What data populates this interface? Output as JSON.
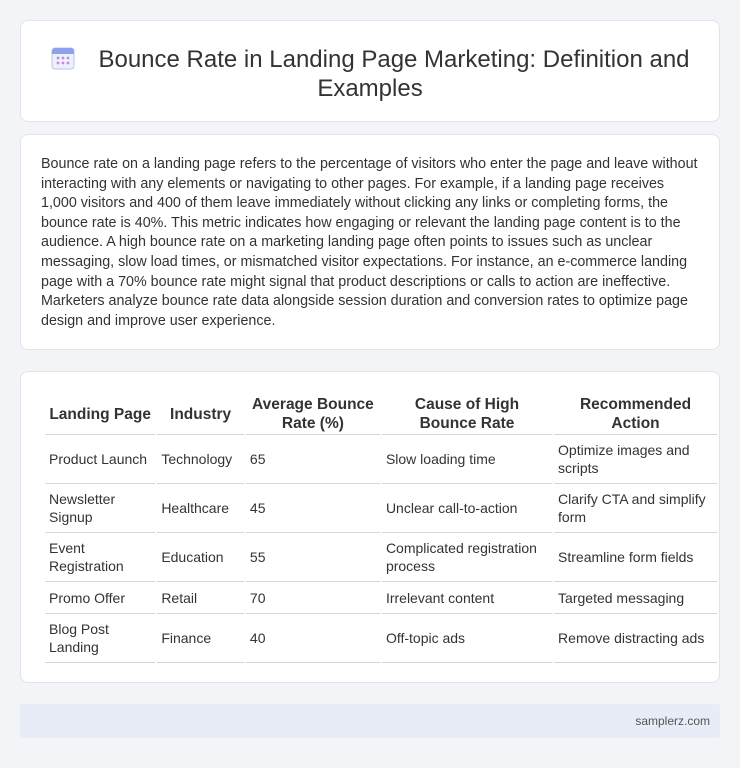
{
  "header": {
    "title": "Bounce Rate in Landing Page Marketing: Definition and Examples",
    "icon": "calendar-icon"
  },
  "description": "Bounce rate on a landing page refers to the percentage of visitors who enter the page and leave without interacting with any elements or navigating to other pages. For example, if a landing page receives 1,000 visitors and 400 of them leave immediately without clicking any links or completing forms, the bounce rate is 40%. This metric indicates how engaging or relevant the landing page content is to the audience. A high bounce rate on a marketing landing page often points to issues such as unclear messaging, slow load times, or mismatched visitor expectations. For instance, an e-commerce landing page with a 70% bounce rate might signal that product descriptions or calls to action are ineffective. Marketers analyze bounce rate data alongside session duration and conversion rates to optimize page design and improve user experience.",
  "table": {
    "headers": [
      "Landing Page",
      "Industry",
      "Average Bounce Rate (%)",
      "Cause of High Bounce Rate",
      "Recommended Action"
    ],
    "rows": [
      [
        "Product Launch",
        "Technology",
        "65",
        "Slow loading time",
        "Optimize images and scripts"
      ],
      [
        "Newsletter Signup",
        "Healthcare",
        "45",
        "Unclear call-to-action",
        "Clarify CTA and simplify form"
      ],
      [
        "Event Registration",
        "Education",
        "55",
        "Complicated registration process",
        "Streamline form fields"
      ],
      [
        "Promo Offer",
        "Retail",
        "70",
        "Irrelevant content",
        "Targeted messaging"
      ],
      [
        "Blog Post Landing",
        "Finance",
        "40",
        "Off-topic ads",
        "Remove distracting ads"
      ]
    ]
  },
  "footer": {
    "site": "samplerz.com"
  },
  "colors": {
    "page_background": "#f3f4f8",
    "card_background": "#ffffff",
    "footer_background": "#e8ecf6",
    "icon_accent": "#7b8ee8"
  }
}
